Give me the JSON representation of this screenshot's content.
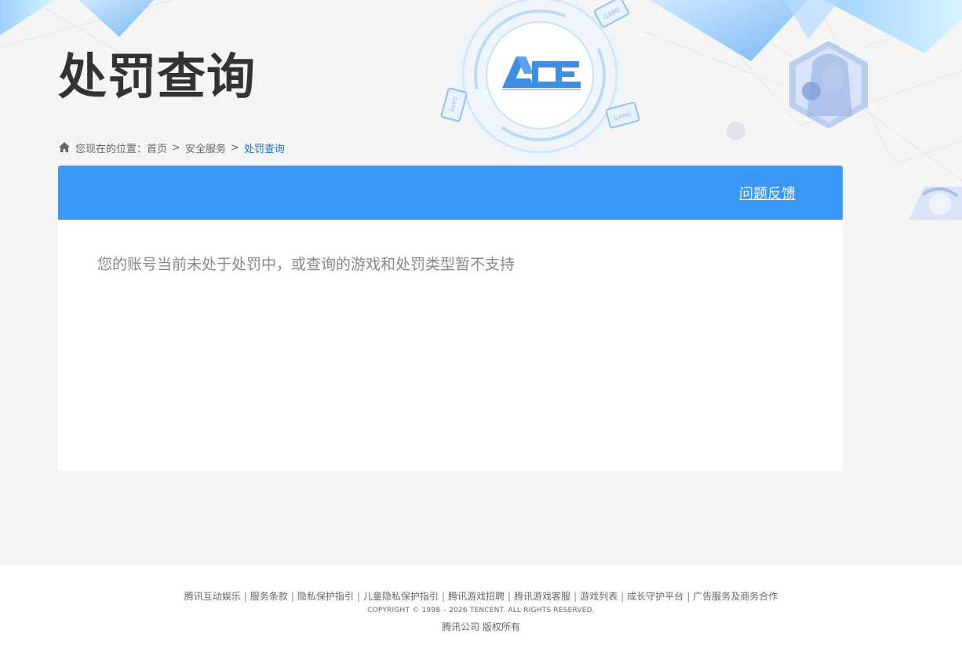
{
  "header": {
    "title": "处罚查询",
    "logo_text": "ACE",
    "game_badge_text": "GAME"
  },
  "breadcrumb": {
    "prefix": "您现在的位置：",
    "items": [
      "首页",
      "安全服务",
      "处罚查询"
    ],
    "separator": ">"
  },
  "panel": {
    "feedback_label": "问题反馈",
    "message": "您的账号当前未处于处罚中，或查询的游戏和处罚类型暂不支持"
  },
  "footer": {
    "links": [
      "腾讯互动娱乐",
      "服务条款",
      "隐私保护指引",
      "儿童隐私保护指引",
      "腾讯游戏招聘",
      "腾讯游戏客服",
      "游戏列表",
      "成长守护平台",
      "广告服务及商务合作"
    ],
    "link_divider": "|",
    "copyright": "COPYRIGHT © 1998 – 2026 TENCENT. ALL RIGHTS RESERVED.",
    "company": "腾讯公司 版权所有"
  },
  "colors": {
    "accent": "#3a98f8",
    "breadcrumb_current": "#1a73c8",
    "title": "#333333",
    "message": "#888888"
  },
  "icons": {
    "home": "home-icon",
    "logo": "ace-logo-icon"
  }
}
